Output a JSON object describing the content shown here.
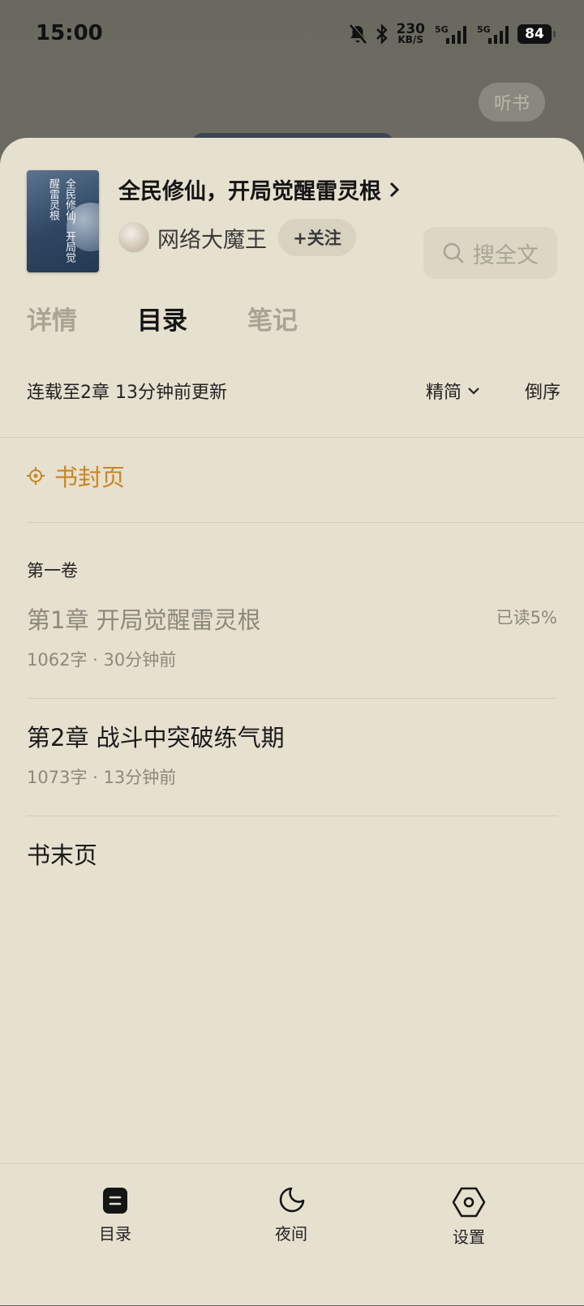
{
  "status": {
    "time": "15:00",
    "net_speed_value": "230",
    "net_speed_unit": "KB/S",
    "signal1_label": "5G",
    "signal2_label": "5G",
    "battery": "84"
  },
  "reader": {
    "listen_label": "听书"
  },
  "book": {
    "title": "全民修仙，开局觉醒雷灵根",
    "cover_text": "全民修仙，开局觉醒雷灵根",
    "author": "网络大魔王",
    "follow_label": "+关注",
    "search_placeholder": "搜全文"
  },
  "tabs": [
    {
      "label": "详情",
      "active": false
    },
    {
      "label": "目录",
      "active": true
    },
    {
      "label": "笔记",
      "active": false
    }
  ],
  "toc": {
    "serial_status": "连载至2章 13分钟前更新",
    "script_option": "精简",
    "order_option": "倒序",
    "cover_page": "书封页",
    "volume": "第一卷",
    "chapters": [
      {
        "name": "第1章 开局觉醒雷灵根",
        "info": "1062字 · 30分钟前",
        "progress": "已读5%"
      },
      {
        "name": "第2章 战斗中突破练气期",
        "info": "1073字 · 13分钟前",
        "progress": ""
      }
    ],
    "end_page": "书末页"
  },
  "bottom_nav": [
    {
      "label": "目录",
      "icon": "toc-icon"
    },
    {
      "label": "夜间",
      "icon": "moon-icon"
    },
    {
      "label": "设置",
      "icon": "settings-icon"
    }
  ],
  "colors": {
    "sheet_bg": "#e6e0cf",
    "accent": "#c98620"
  }
}
